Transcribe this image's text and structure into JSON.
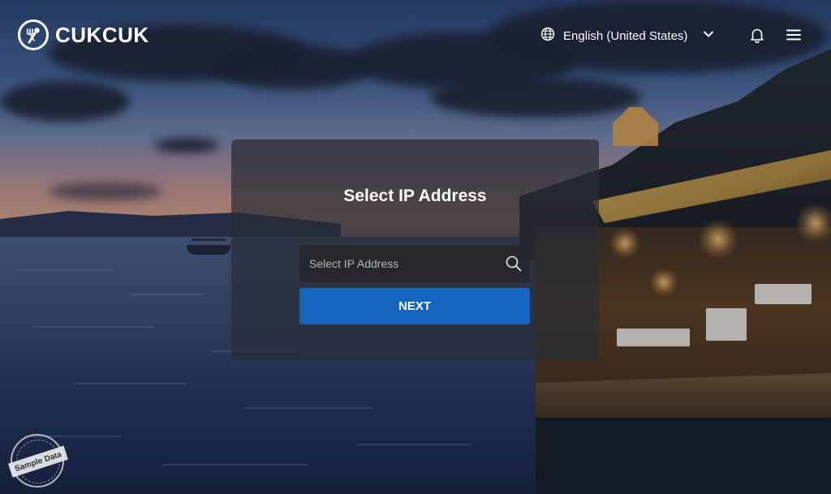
{
  "header": {
    "logo_text": "CUKCUK",
    "language": "English (United States)",
    "icons": {
      "globe": "globe-icon",
      "dropdown": "chevron-down-icon",
      "notifications": "bell-icon",
      "menu": "menu-icon"
    }
  },
  "dialog": {
    "title": "Select IP Address",
    "search_placeholder": "Select IP Address",
    "search_value": "",
    "next_label": "NEXT"
  },
  "watermark": {
    "text": "Sample Data"
  },
  "colors": {
    "primary_button": "#1565c0",
    "card_background": "rgba(40,44,52,0.72)",
    "text_on_dark": "#ffffff"
  }
}
